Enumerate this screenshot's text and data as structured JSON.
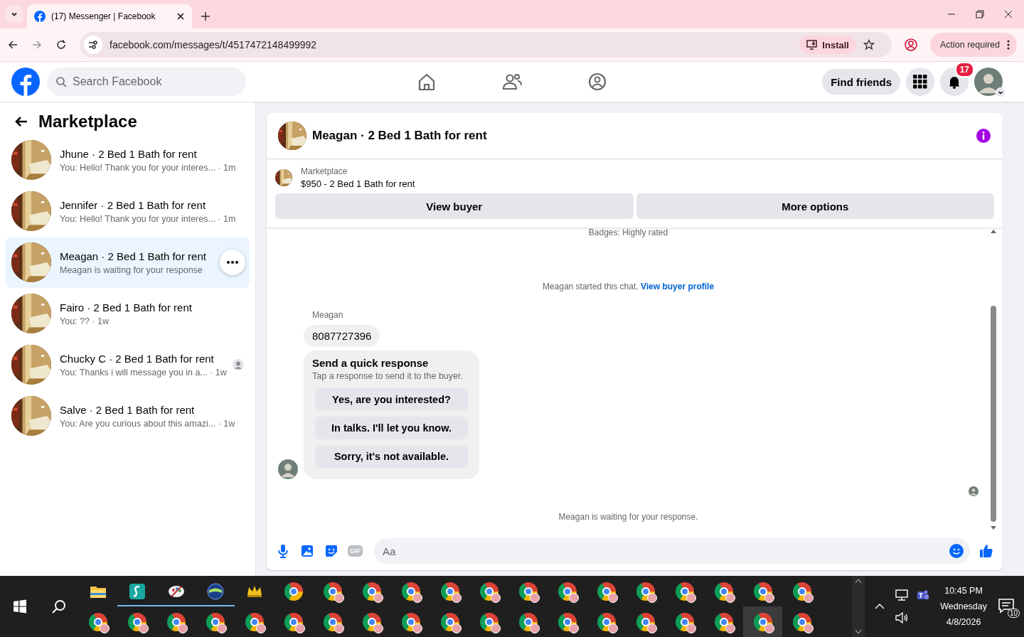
{
  "browser": {
    "tab_title": "(17) Messenger | Facebook",
    "url": "facebook.com/messages/t/4517472148499992",
    "install": "Install",
    "action": "Action required"
  },
  "header": {
    "search_placeholder": "Search Facebook",
    "find_friends": "Find friends",
    "notifications": "17"
  },
  "sidebar": {
    "title": "Marketplace",
    "conversations": [
      {
        "title": "Jhune · 2 Bed 1 Bath for rent",
        "preview": "You: Hello! Thank you for your interes... · 1m",
        "selected": false,
        "seen": false
      },
      {
        "title": "Jennifer · 2 Bed 1 Bath for rent",
        "preview": "You: Hello! Thank you for your interes... · 1m",
        "selected": false,
        "seen": false
      },
      {
        "title": "Meagan · 2 Bed 1 Bath for rent",
        "preview": "Meagan is waiting for your response",
        "selected": true,
        "seen": false
      },
      {
        "title": "Fairo · 2 Bed 1 Bath for rent",
        "preview": "You: ?? · 1w",
        "selected": false,
        "seen": false
      },
      {
        "title": "Chucky C · 2 Bed 1 Bath for rent",
        "preview": "You: Thanks i will message you in a... · 1w",
        "selected": false,
        "seen": true
      },
      {
        "title": "Salve · 2 Bed 1 Bath for rent",
        "preview": "You: Are you curious about this amazi... · 1w",
        "selected": false,
        "seen": false
      }
    ]
  },
  "chat": {
    "title": "Meagan · 2 Bed 1 Bath for rent",
    "listing": {
      "label": "Marketplace",
      "title": "$950 - 2 Bed 1 Bath for rent"
    },
    "actions": [
      "View buyer",
      "More options"
    ],
    "messages": [
      {
        "kind": "note",
        "text": "Badges: Highly rated"
      },
      {
        "kind": "started",
        "text": "Meagan started this chat.",
        "link": "View buyer profile"
      },
      {
        "kind": "group",
        "sender": "Meagan",
        "items": [
          {
            "kind": "text",
            "text": "8087727396"
          },
          {
            "kind": "quick_responses",
            "title": "Send a quick response",
            "subtitle": "Tap a response to send it to the buyer.",
            "options": [
              "Yes, are you interested?",
              "In talks. I'll let you know.",
              "Sorry, it's not available."
            ]
          }
        ]
      },
      {
        "kind": "seen"
      },
      {
        "kind": "note",
        "text": "Meagan is waiting for your response."
      }
    ],
    "composer": {
      "gif_label": "GIF",
      "placeholder": "Aa"
    }
  },
  "taskbar": {
    "rows": [
      [
        {
          "kind": "folder",
          "running": false,
          "selected": false
        },
        {
          "kind": "app_s",
          "running": true,
          "selected": false
        },
        {
          "kind": "app_paint",
          "running": true,
          "selected": false
        },
        {
          "kind": "app_globe",
          "running": true,
          "selected": false
        },
        {
          "kind": "app_crown",
          "running": false,
          "selected": false
        },
        {
          "kind": "browser",
          "running": false,
          "selected": false
        },
        {
          "kind": "browser_profile",
          "running": false,
          "selected": false
        },
        {
          "kind": "browser_profile",
          "running": false,
          "selected": false
        },
        {
          "kind": "browser_profile",
          "running": false,
          "selected": false
        },
        {
          "kind": "browser_profile",
          "running": false,
          "selected": false
        },
        {
          "kind": "browser_profile",
          "running": false,
          "selected": false
        },
        {
          "kind": "browser_profile",
          "running": false,
          "selected": false
        },
        {
          "kind": "browser_profile",
          "running": false,
          "selected": false
        },
        {
          "kind": "browser_profile",
          "running": false,
          "selected": false
        },
        {
          "kind": "browser_profile",
          "running": false,
          "selected": false
        },
        {
          "kind": "browser_profile",
          "running": false,
          "selected": false
        },
        {
          "kind": "browser_profile",
          "running": false,
          "selected": false
        },
        {
          "kind": "browser_profile",
          "running": false,
          "selected": false
        },
        {
          "kind": "browser_profile",
          "running": false,
          "selected": false
        }
      ],
      [
        {
          "kind": "browser_profile",
          "running": false,
          "selected": false
        },
        {
          "kind": "browser_profile",
          "running": false,
          "selected": false
        },
        {
          "kind": "browser_profile",
          "running": false,
          "selected": false
        },
        {
          "kind": "browser_profile",
          "running": false,
          "selected": false
        },
        {
          "kind": "browser_profile",
          "running": false,
          "selected": false
        },
        {
          "kind": "browser_profile",
          "running": false,
          "selected": false
        },
        {
          "kind": "browser_profile",
          "running": false,
          "selected": false
        },
        {
          "kind": "browser_profile",
          "running": false,
          "selected": false
        },
        {
          "kind": "browser_profile",
          "running": false,
          "selected": false
        },
        {
          "kind": "browser_profile",
          "running": false,
          "selected": false
        },
        {
          "kind": "browser_profile",
          "running": false,
          "selected": false
        },
        {
          "kind": "browser_profile",
          "running": false,
          "selected": false
        },
        {
          "kind": "browser_profile",
          "running": false,
          "selected": false
        },
        {
          "kind": "browser_profile",
          "running": false,
          "selected": false
        },
        {
          "kind": "browser_profile",
          "running": false,
          "selected": false
        },
        {
          "kind": "browser_profile",
          "running": false,
          "selected": false
        },
        {
          "kind": "browser_profile",
          "running": false,
          "selected": false
        },
        {
          "kind": "browser_profile",
          "running": false,
          "selected": true
        },
        {
          "kind": "browser_profile",
          "running": false,
          "selected": false
        }
      ]
    ],
    "time": "10:45 PM",
    "day": "Wednesday",
    "date": "4/8/2026",
    "notifications": "10"
  }
}
